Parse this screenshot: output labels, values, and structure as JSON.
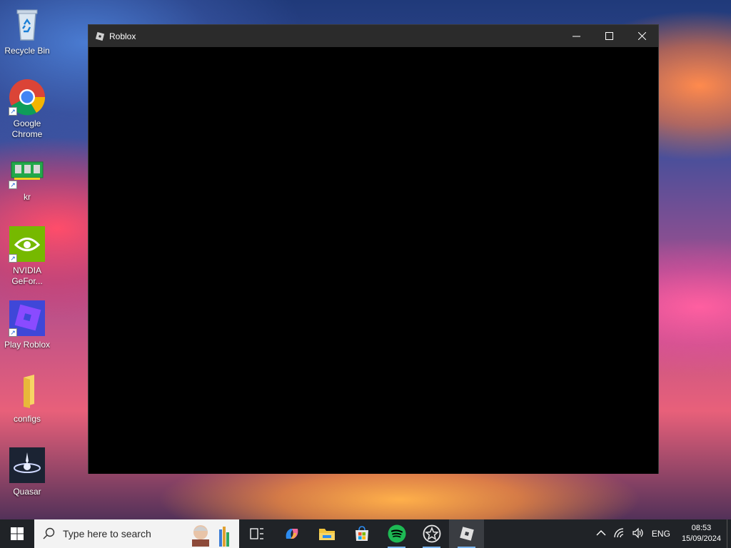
{
  "desktop": {
    "icons": [
      {
        "label": "Recycle Bin",
        "icon": "recycle-bin-icon"
      },
      {
        "label": "Google Chrome",
        "icon": "chrome-icon"
      },
      {
        "label": "kr",
        "icon": "memory-chip-icon"
      },
      {
        "label": "NVIDIA GeFor...",
        "icon": "nvidia-icon"
      },
      {
        "label": "Play Roblox",
        "icon": "roblox-icon"
      },
      {
        "label": "configs",
        "icon": "folder-icon"
      },
      {
        "label": "Quasar",
        "icon": "quasar-icon"
      }
    ]
  },
  "window": {
    "title": "Roblox",
    "controls": {
      "minimize": "—",
      "maximize": "☐",
      "close": "✕"
    }
  },
  "taskbar": {
    "search_placeholder": "Type here to search",
    "apps": [
      "task-view",
      "copilot",
      "file-explorer",
      "microsoft-store",
      "spotify",
      "star-app",
      "roblox"
    ],
    "tray": {
      "language": "ENG",
      "time": "08:53",
      "date": "15/09/2024"
    }
  },
  "colors": {
    "taskbar": "#202327",
    "titlebar": "#2b2b2b",
    "spotify": "#1db954",
    "nvidia": "#76b900"
  }
}
